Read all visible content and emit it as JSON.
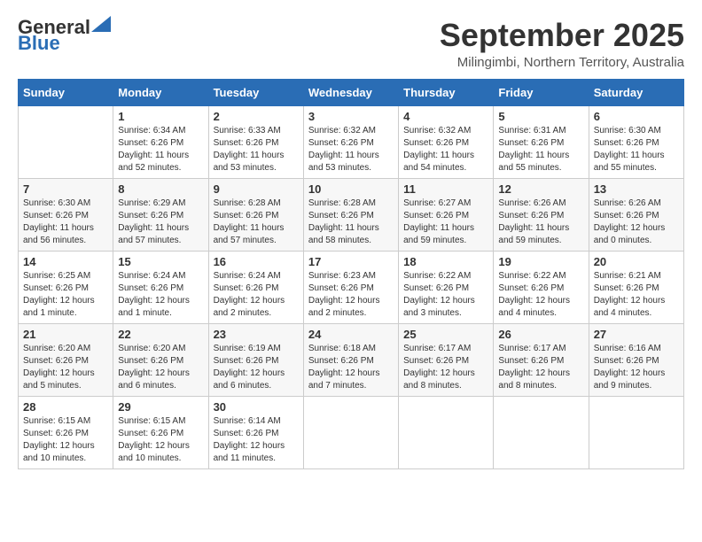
{
  "header": {
    "logo_general": "General",
    "logo_blue": "Blue",
    "month": "September 2025",
    "location": "Milingimbi, Northern Territory, Australia"
  },
  "days_of_week": [
    "Sunday",
    "Monday",
    "Tuesday",
    "Wednesday",
    "Thursday",
    "Friday",
    "Saturday"
  ],
  "weeks": [
    [
      {
        "day": "",
        "details": ""
      },
      {
        "day": "1",
        "details": "Sunrise: 6:34 AM\nSunset: 6:26 PM\nDaylight: 11 hours\nand 52 minutes."
      },
      {
        "day": "2",
        "details": "Sunrise: 6:33 AM\nSunset: 6:26 PM\nDaylight: 11 hours\nand 53 minutes."
      },
      {
        "day": "3",
        "details": "Sunrise: 6:32 AM\nSunset: 6:26 PM\nDaylight: 11 hours\nand 53 minutes."
      },
      {
        "day": "4",
        "details": "Sunrise: 6:32 AM\nSunset: 6:26 PM\nDaylight: 11 hours\nand 54 minutes."
      },
      {
        "day": "5",
        "details": "Sunrise: 6:31 AM\nSunset: 6:26 PM\nDaylight: 11 hours\nand 55 minutes."
      },
      {
        "day": "6",
        "details": "Sunrise: 6:30 AM\nSunset: 6:26 PM\nDaylight: 11 hours\nand 55 minutes."
      }
    ],
    [
      {
        "day": "7",
        "details": "Sunrise: 6:30 AM\nSunset: 6:26 PM\nDaylight: 11 hours\nand 56 minutes."
      },
      {
        "day": "8",
        "details": "Sunrise: 6:29 AM\nSunset: 6:26 PM\nDaylight: 11 hours\nand 57 minutes."
      },
      {
        "day": "9",
        "details": "Sunrise: 6:28 AM\nSunset: 6:26 PM\nDaylight: 11 hours\nand 57 minutes."
      },
      {
        "day": "10",
        "details": "Sunrise: 6:28 AM\nSunset: 6:26 PM\nDaylight: 11 hours\nand 58 minutes."
      },
      {
        "day": "11",
        "details": "Sunrise: 6:27 AM\nSunset: 6:26 PM\nDaylight: 11 hours\nand 59 minutes."
      },
      {
        "day": "12",
        "details": "Sunrise: 6:26 AM\nSunset: 6:26 PM\nDaylight: 11 hours\nand 59 minutes."
      },
      {
        "day": "13",
        "details": "Sunrise: 6:26 AM\nSunset: 6:26 PM\nDaylight: 12 hours\nand 0 minutes."
      }
    ],
    [
      {
        "day": "14",
        "details": "Sunrise: 6:25 AM\nSunset: 6:26 PM\nDaylight: 12 hours\nand 1 minute."
      },
      {
        "day": "15",
        "details": "Sunrise: 6:24 AM\nSunset: 6:26 PM\nDaylight: 12 hours\nand 1 minute."
      },
      {
        "day": "16",
        "details": "Sunrise: 6:24 AM\nSunset: 6:26 PM\nDaylight: 12 hours\nand 2 minutes."
      },
      {
        "day": "17",
        "details": "Sunrise: 6:23 AM\nSunset: 6:26 PM\nDaylight: 12 hours\nand 2 minutes."
      },
      {
        "day": "18",
        "details": "Sunrise: 6:22 AM\nSunset: 6:26 PM\nDaylight: 12 hours\nand 3 minutes."
      },
      {
        "day": "19",
        "details": "Sunrise: 6:22 AM\nSunset: 6:26 PM\nDaylight: 12 hours\nand 4 minutes."
      },
      {
        "day": "20",
        "details": "Sunrise: 6:21 AM\nSunset: 6:26 PM\nDaylight: 12 hours\nand 4 minutes."
      }
    ],
    [
      {
        "day": "21",
        "details": "Sunrise: 6:20 AM\nSunset: 6:26 PM\nDaylight: 12 hours\nand 5 minutes."
      },
      {
        "day": "22",
        "details": "Sunrise: 6:20 AM\nSunset: 6:26 PM\nDaylight: 12 hours\nand 6 minutes."
      },
      {
        "day": "23",
        "details": "Sunrise: 6:19 AM\nSunset: 6:26 PM\nDaylight: 12 hours\nand 6 minutes."
      },
      {
        "day": "24",
        "details": "Sunrise: 6:18 AM\nSunset: 6:26 PM\nDaylight: 12 hours\nand 7 minutes."
      },
      {
        "day": "25",
        "details": "Sunrise: 6:17 AM\nSunset: 6:26 PM\nDaylight: 12 hours\nand 8 minutes."
      },
      {
        "day": "26",
        "details": "Sunrise: 6:17 AM\nSunset: 6:26 PM\nDaylight: 12 hours\nand 8 minutes."
      },
      {
        "day": "27",
        "details": "Sunrise: 6:16 AM\nSunset: 6:26 PM\nDaylight: 12 hours\nand 9 minutes."
      }
    ],
    [
      {
        "day": "28",
        "details": "Sunrise: 6:15 AM\nSunset: 6:26 PM\nDaylight: 12 hours\nand 10 minutes."
      },
      {
        "day": "29",
        "details": "Sunrise: 6:15 AM\nSunset: 6:26 PM\nDaylight: 12 hours\nand 10 minutes."
      },
      {
        "day": "30",
        "details": "Sunrise: 6:14 AM\nSunset: 6:26 PM\nDaylight: 12 hours\nand 11 minutes."
      },
      {
        "day": "",
        "details": ""
      },
      {
        "day": "",
        "details": ""
      },
      {
        "day": "",
        "details": ""
      },
      {
        "day": "",
        "details": ""
      }
    ]
  ]
}
